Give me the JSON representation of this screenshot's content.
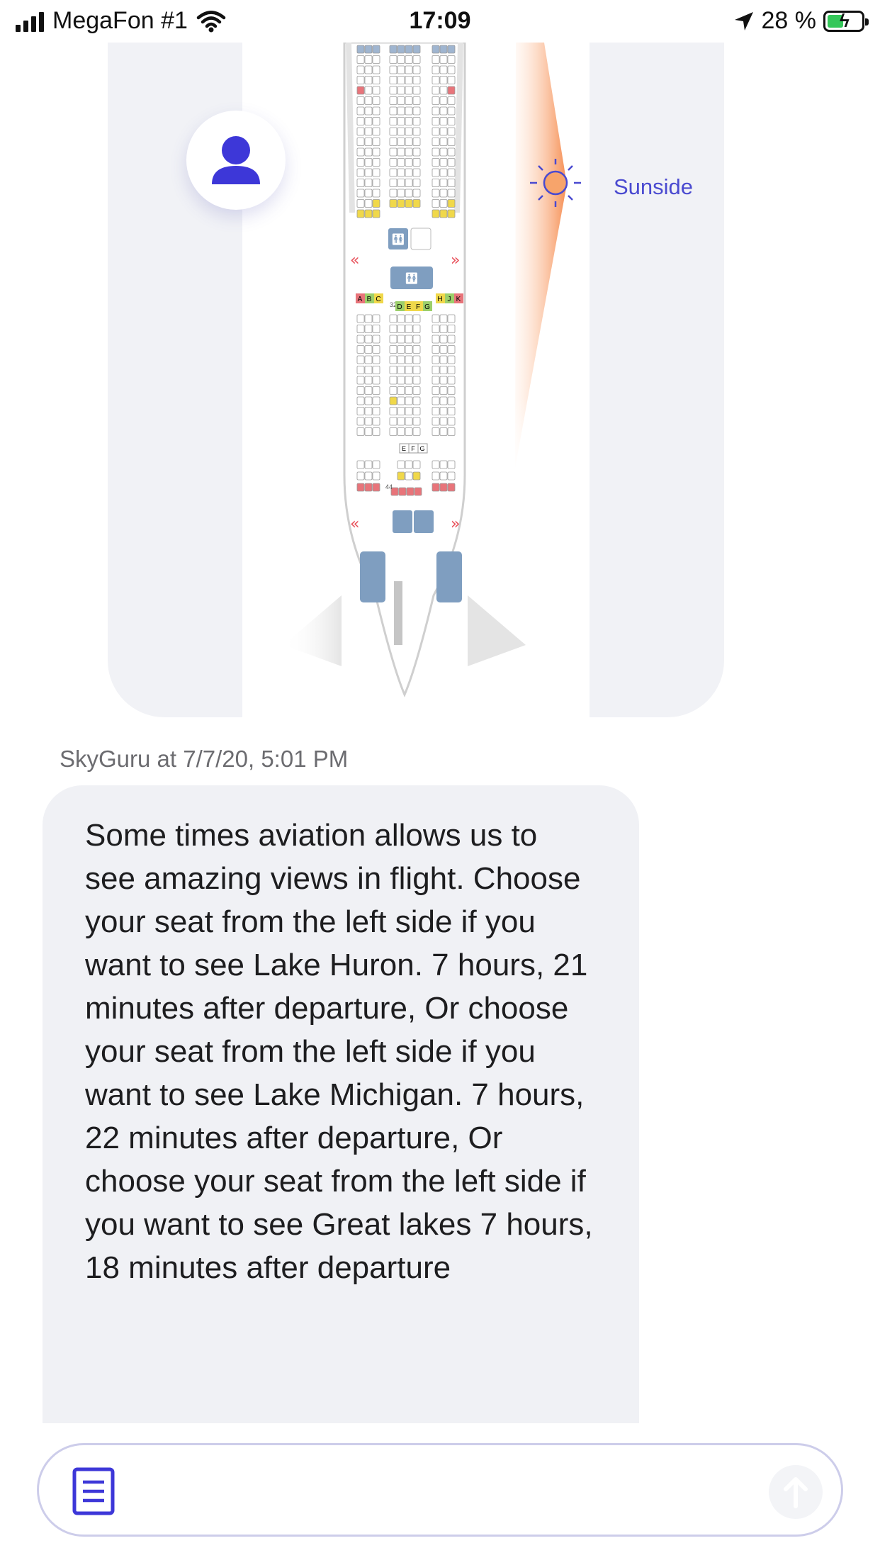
{
  "status_bar": {
    "carrier": "MegaFon #1",
    "time": "17:09",
    "battery_percent": "28 %",
    "icons": [
      "signal-icon",
      "wifi-icon",
      "location-arrow-icon",
      "battery-charging-icon"
    ]
  },
  "seat_map": {
    "sun_label": "Sunside",
    "left_row_letters": [
      "A",
      "B",
      "C"
    ],
    "middle_row_letters": [
      "D",
      "E",
      "F",
      "G"
    ],
    "right_row_letters": [
      "H",
      "J",
      "K"
    ],
    "row_number_32": "32",
    "row_number_44": "44",
    "efg_letters": [
      "E",
      "F",
      "G"
    ],
    "colors": {
      "seat": "#ffffff",
      "seat_border": "#9a9a9a",
      "seat_red": "#e8747a",
      "seat_yellow": "#f0d84a",
      "seat_green": "#9ccf6a",
      "facility": "#7f9ec0",
      "sun_gradient": "#f6a06a"
    }
  },
  "message": {
    "sender_meta": "SkyGuru at 7/7/20, 5:01 PM",
    "text": "Some times aviation allows us to see amazing views in flight. Choose your seat from the left side if you want to see Lake Huron. 7 hours, 21 minutes after departure, Or  choose your seat from the left side if you want to see Lake Michigan. 7 hours, 22 minutes after departure, Or  choose your seat from the left side if you want to see Great lakes 7 hours, 18 minutes after departure"
  },
  "composer": {
    "icons": [
      "document-icon",
      "send-arrow-icon"
    ]
  },
  "theme": {
    "accent": "#3d37d8",
    "bubble_bg": "#f0f1f5",
    "panel_bg": "#f1f2f6"
  }
}
